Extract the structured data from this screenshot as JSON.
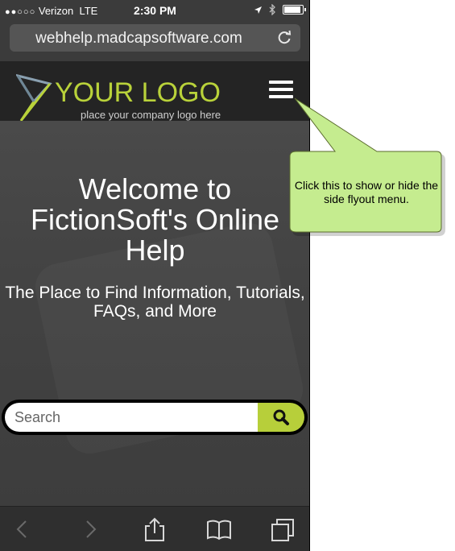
{
  "status_bar": {
    "signal_dots": "●●○○○",
    "carrier": "Verizon",
    "network": "LTE",
    "time": "2:30 PM"
  },
  "browser": {
    "url": "webhelp.madcapsoftware.com"
  },
  "header": {
    "logo_text": "YOUR LOGO",
    "logo_subtext": "place your company logo here",
    "logo_color": "#b9d23a"
  },
  "hero": {
    "title": "Welcome to FictionSoft's Online Help",
    "tagline": "The Place to Find Information, Tutorials, FAQs, and More"
  },
  "search": {
    "placeholder": "Search",
    "button_color": "#b7cf3a"
  },
  "toolbar": {
    "icons": [
      "back-icon",
      "forward-icon",
      "share-icon",
      "bookmarks-icon",
      "tabs-icon"
    ]
  },
  "callout": {
    "text": "Click this to show or hide the side flyout menu.",
    "fill": "#c5ec8f"
  }
}
